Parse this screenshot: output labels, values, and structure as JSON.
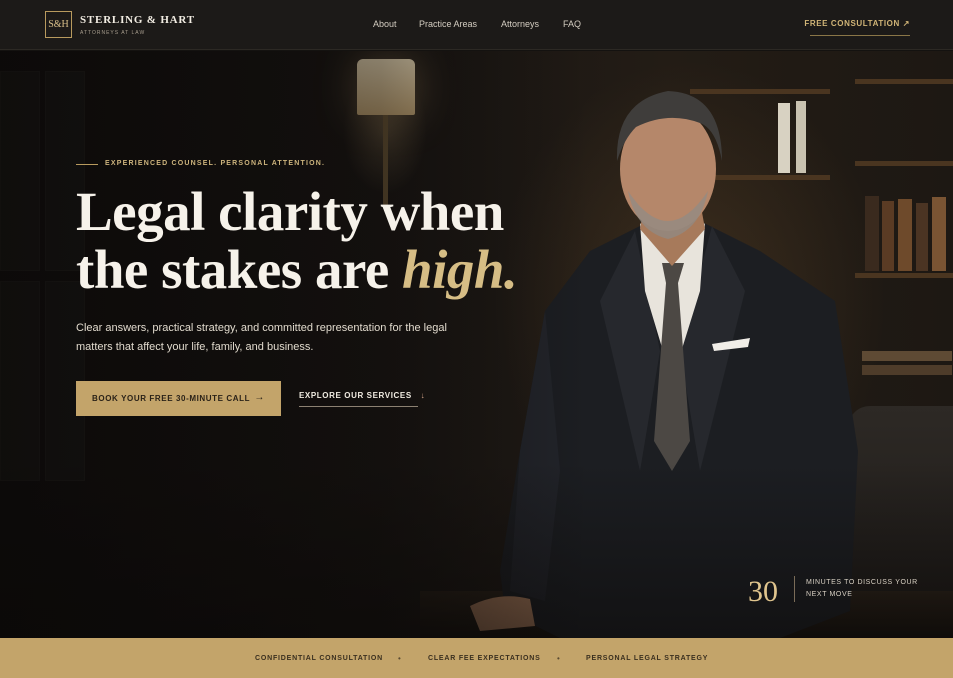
{
  "nav": {
    "logo_mark": "S&H",
    "brand_name": "STERLING & HART",
    "brand_sub": "ATTORNEYS AT LAW",
    "links": [
      "About",
      "Practice Areas",
      "Attorneys",
      "FAQ"
    ],
    "cta": "FREE CONSULTATION ↗"
  },
  "hero": {
    "eyebrow": "EXPERIENCED COUNSEL. PERSONAL ATTENTION.",
    "headline_line1": "Legal clarity when",
    "headline_line2_pre": "the stakes are ",
    "headline_accent": "high.",
    "subtext": "Clear answers, practical strategy, and committed representation for the legal matters that affect your life, family, and business.",
    "cta_primary": "BOOK YOUR FREE 30-MINUTE CALL",
    "cta_primary_arrow": "→",
    "cta_secondary": "EXPLORE OUR SERVICES",
    "cta_secondary_arrow": "↓",
    "stat_number": "30",
    "stat_label": "MINUTES TO DISCUSS YOUR NEXT MOVE"
  },
  "bottom_bar": {
    "items": [
      "CONFIDENTIAL CONSULTATION",
      "CLEAR FEE EXPECTATIONS",
      "PERSONAL LEGAL STRATEGY"
    ],
    "separator": "•"
  },
  "colors": {
    "gold": "#c3a46a",
    "accent_text": "#d6bd85",
    "dark_bg": "#1c1a18"
  }
}
